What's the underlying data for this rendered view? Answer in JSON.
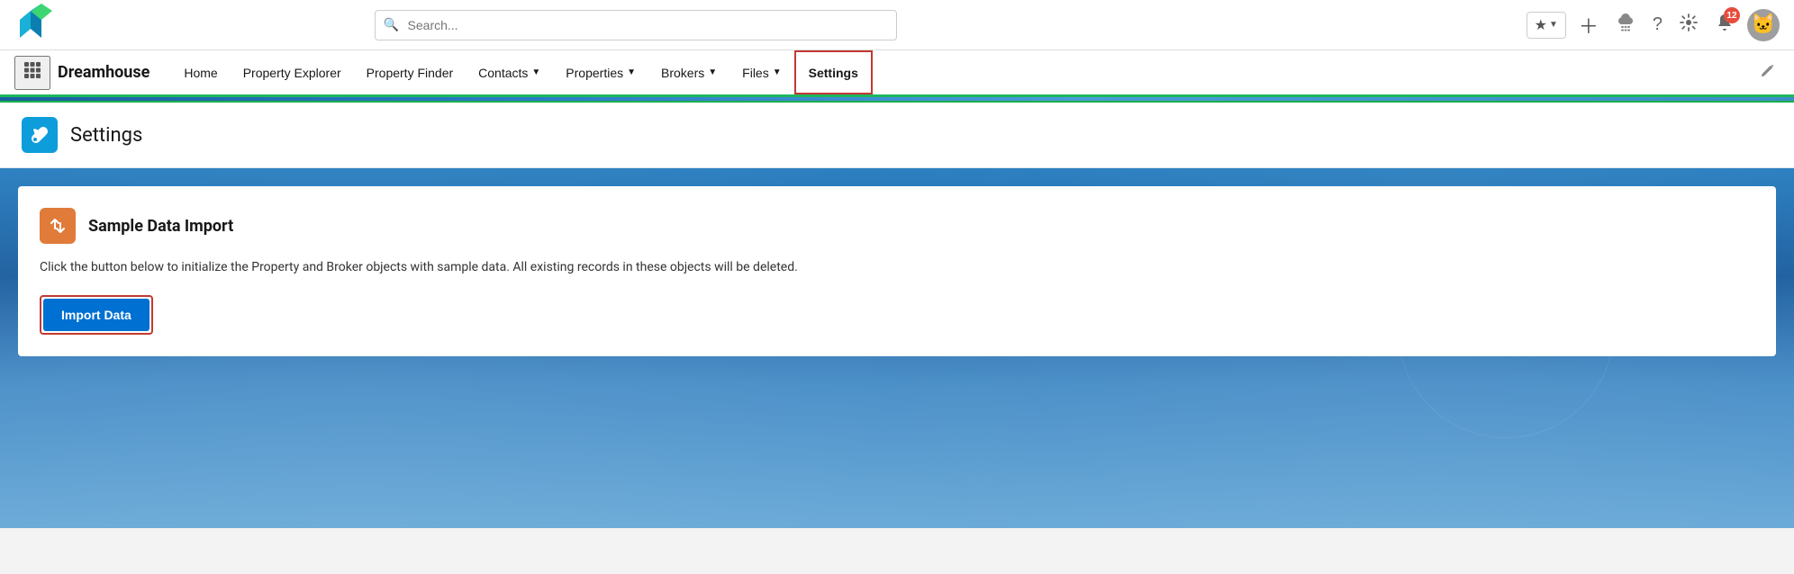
{
  "app": {
    "name": "Dreamhouse"
  },
  "topbar": {
    "search_placeholder": "Search...",
    "notification_count": "12"
  },
  "nav": {
    "items": [
      {
        "label": "Home",
        "has_dropdown": false,
        "active": false
      },
      {
        "label": "Property Explorer",
        "has_dropdown": false,
        "active": false
      },
      {
        "label": "Property Finder",
        "has_dropdown": false,
        "active": false
      },
      {
        "label": "Contacts",
        "has_dropdown": true,
        "active": false
      },
      {
        "label": "Properties",
        "has_dropdown": true,
        "active": false
      },
      {
        "label": "Brokers",
        "has_dropdown": true,
        "active": false
      },
      {
        "label": "Files",
        "has_dropdown": true,
        "active": false
      },
      {
        "label": "Settings",
        "has_dropdown": false,
        "active": true
      }
    ]
  },
  "page": {
    "title": "Settings",
    "icon_label": "settings-wrench"
  },
  "card": {
    "title": "Sample Data Import",
    "description": "Click the button below to initialize the Property and Broker objects with sample data. All existing records in these objects will be deleted.",
    "import_button_label": "Import Data",
    "icon_label": "transfer-arrows"
  }
}
